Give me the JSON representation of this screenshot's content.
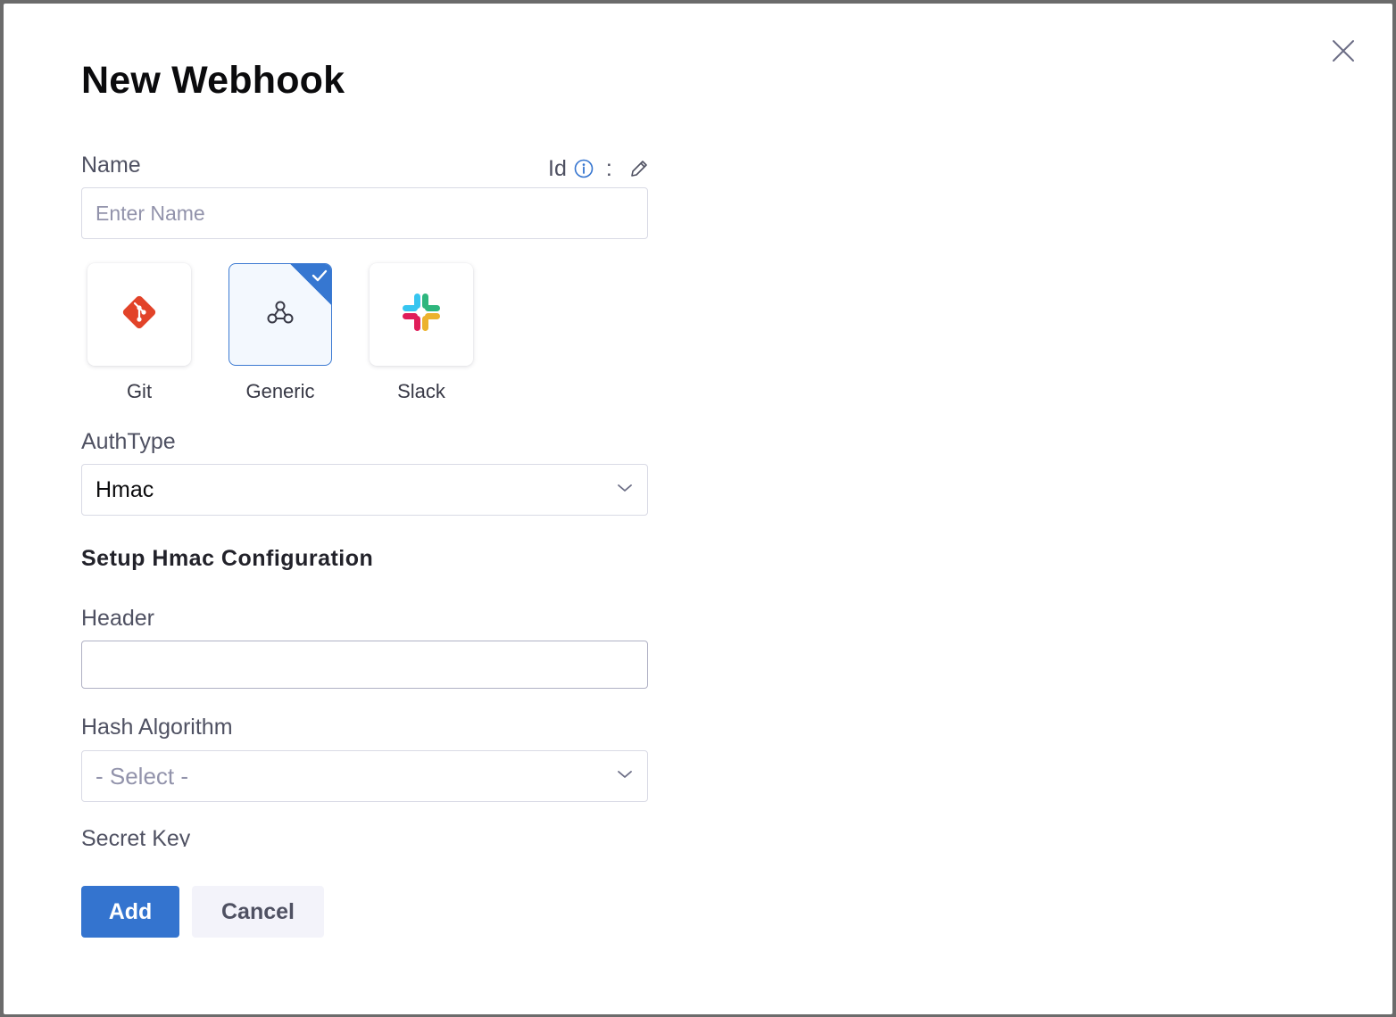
{
  "dialog": {
    "title": "New Webhook"
  },
  "name_field": {
    "label": "Name",
    "placeholder": "Enter Name",
    "value": "",
    "id_label": "Id",
    "id_separator": ":"
  },
  "types": [
    {
      "label": "Git",
      "icon": "git-icon",
      "selected": false
    },
    {
      "label": "Generic",
      "icon": "webhook-icon",
      "selected": true
    },
    {
      "label": "Slack",
      "icon": "slack-icon",
      "selected": false
    }
  ],
  "auth_type": {
    "label": "AuthType",
    "value": "Hmac"
  },
  "hmac": {
    "section_title": "Setup Hmac Configuration",
    "header_label": "Header",
    "header_value": "",
    "hash_label": "Hash Algorithm",
    "hash_placeholder": "- Select -",
    "secret_label": "Secret Key"
  },
  "actions": {
    "add_label": "Add",
    "cancel_label": "Cancel"
  },
  "colors": {
    "primary": "#3474cf",
    "selected_border": "#3c7ad2",
    "git": "#e24329",
    "info": "#3474cf"
  }
}
